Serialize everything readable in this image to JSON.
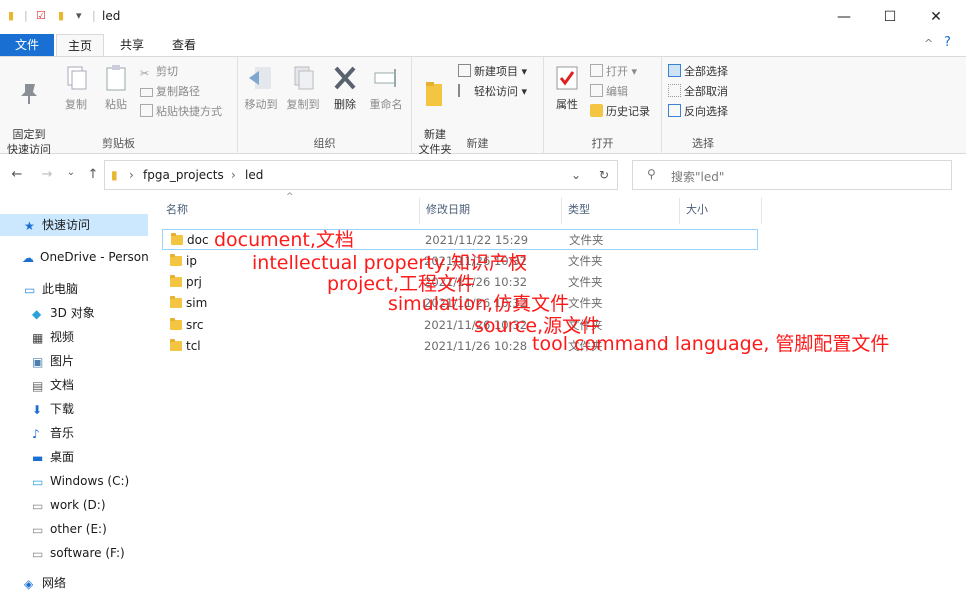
{
  "window": {
    "title": "led",
    "controls": {
      "minimize": "—",
      "maximize": "☐",
      "close": "✕"
    }
  },
  "ribbon_tabs": [
    "文件",
    "主页",
    "共享",
    "查看"
  ],
  "ribbon": {
    "clipboard": {
      "label": "剪贴板",
      "pin": "固定到\n快速访问",
      "copy": "复制",
      "paste": "粘贴",
      "cut": "剪切",
      "copy_path": "复制路径",
      "paste_shortcut": "粘贴快捷方式"
    },
    "organize": {
      "label": "组织",
      "move_to": "移动到",
      "copy_to": "复制到",
      "delete": "删除",
      "rename": "重命名"
    },
    "new": {
      "label": "新建",
      "new_folder": "新建\n文件夹",
      "new_item": "新建项目 ▾",
      "easy_access": "轻松访问 ▾"
    },
    "open": {
      "label": "打开",
      "properties": "属性",
      "open": "打开 ▾",
      "edit": "编辑",
      "history": "历史记录"
    },
    "select": {
      "label": "选择",
      "select_all": "全部选择",
      "select_none": "全部取消",
      "invert": "反向选择"
    }
  },
  "address": {
    "crumbs": [
      "fpga_projects",
      "led"
    ],
    "search_placeholder": "搜索\"led\""
  },
  "sidebar": [
    {
      "label": "快速访问",
      "icon": "star-icon"
    },
    {
      "label": "OneDrive - Personal",
      "icon": "cloud-icon"
    },
    {
      "label": "此电脑",
      "icon": "computer-icon"
    },
    {
      "label": "3D 对象",
      "icon": "cube-icon"
    },
    {
      "label": "视频",
      "icon": "video-icon"
    },
    {
      "label": "图片",
      "icon": "picture-icon"
    },
    {
      "label": "文档",
      "icon": "document-icon"
    },
    {
      "label": "下载",
      "icon": "download-icon"
    },
    {
      "label": "音乐",
      "icon": "music-icon"
    },
    {
      "label": "桌面",
      "icon": "desktop-icon"
    },
    {
      "label": "Windows (C:)",
      "icon": "windows-drive-icon"
    },
    {
      "label": "work (D:)",
      "icon": "drive-icon"
    },
    {
      "label": "other (E:)",
      "icon": "drive-icon"
    },
    {
      "label": "software (F:)",
      "icon": "drive-icon"
    },
    {
      "label": "网络",
      "icon": "network-icon"
    }
  ],
  "columns": [
    "名称",
    "修改日期",
    "类型",
    "大小"
  ],
  "files": [
    {
      "name": "doc",
      "date": "2021/11/22 15:29",
      "type": "文件夹"
    },
    {
      "name": "ip",
      "date": "2021/11/26 10:32",
      "type": "文件夹"
    },
    {
      "name": "prj",
      "date": "2021/11/26 10:32",
      "type": "文件夹"
    },
    {
      "name": "sim",
      "date": "2021/11/26 10:32",
      "type": "文件夹"
    },
    {
      "name": "src",
      "date": "2021/11/26 10:32",
      "type": "文件夹"
    },
    {
      "name": "tcl",
      "date": "2021/11/26 10:28",
      "type": "文件夹"
    }
  ],
  "annotations": [
    "document,文档",
    "intellectual property,知识产权",
    "project,工程文件",
    "simulation,仿真文件",
    "source,源文件",
    "tool command language, 管脚配置文件"
  ],
  "colors": {
    "accent": "#1a6fd2",
    "annotation": "#ff1a1a",
    "selection": "#cce8ff"
  }
}
